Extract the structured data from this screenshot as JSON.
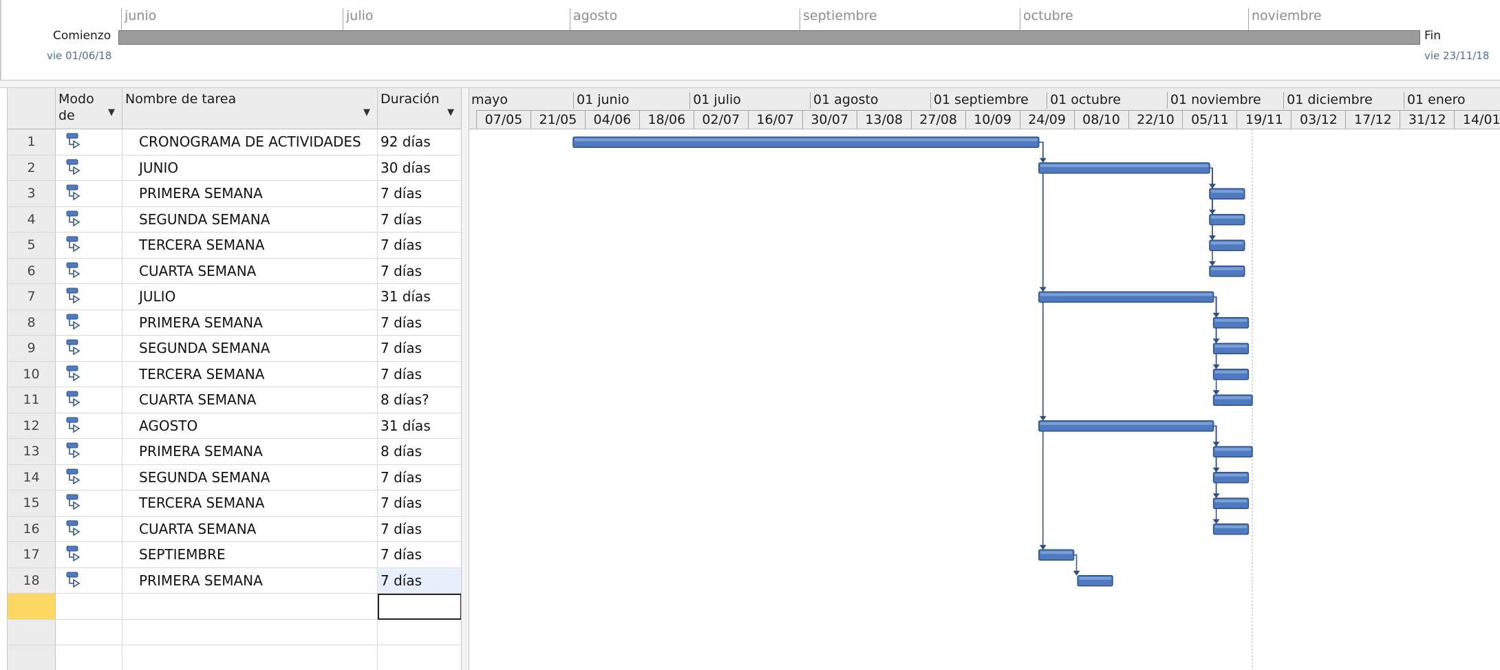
{
  "timeline": {
    "months": [
      "junio",
      "julio",
      "agosto",
      "septiembre",
      "octubre",
      "noviembre"
    ],
    "start_label": "Comienzo",
    "start_date": "vie 01/06/18",
    "end_label": "Fin",
    "end_date": "vie 23/11/18"
  },
  "table": {
    "headers": {
      "mode": "Modo de",
      "name": "Nombre de tarea",
      "duration": "Duración"
    },
    "icons": {
      "mode": "auto-schedule-task-icon",
      "dropdown": "dropdown-arrow-icon"
    },
    "rows": [
      {
        "id": "1",
        "name": "CRONOGRAMA DE ACTIVIDADES",
        "duration": "92 días"
      },
      {
        "id": "2",
        "name": "JUNIO",
        "duration": "30 días"
      },
      {
        "id": "3",
        "name": "PRIMERA SEMANA",
        "duration": "7 días"
      },
      {
        "id": "4",
        "name": "SEGUNDA SEMANA",
        "duration": "7 días"
      },
      {
        "id": "5",
        "name": "TERCERA SEMANA",
        "duration": "7 días"
      },
      {
        "id": "6",
        "name": "CUARTA SEMANA",
        "duration": "7 días"
      },
      {
        "id": "7",
        "name": "JULIO",
        "duration": "31 días"
      },
      {
        "id": "8",
        "name": "PRIMERA SEMANA",
        "duration": "7 días"
      },
      {
        "id": "9",
        "name": "SEGUNDA SEMANA",
        "duration": "7 días"
      },
      {
        "id": "10",
        "name": "TERCERA SEMANA",
        "duration": "7 días"
      },
      {
        "id": "11",
        "name": "CUARTA SEMANA",
        "duration": "8 días?"
      },
      {
        "id": "12",
        "name": "AGOSTO",
        "duration": "31 días"
      },
      {
        "id": "13",
        "name": "PRIMERA SEMANA",
        "duration": "8 días"
      },
      {
        "id": "14",
        "name": "SEGUNDA SEMANA",
        "duration": "7 días"
      },
      {
        "id": "15",
        "name": "TERCERA SEMANA",
        "duration": "7 días"
      },
      {
        "id": "16",
        "name": "CUARTA SEMANA",
        "duration": "7 días"
      },
      {
        "id": "17",
        "name": "SEPTIEMBRE",
        "duration": "7 días"
      },
      {
        "id": "18",
        "name": "PRIMERA SEMANA",
        "duration": "7 días"
      }
    ]
  },
  "gantt": {
    "months": [
      "mayo",
      "01 junio",
      "01 julio",
      "01 agosto",
      "01 septiembre",
      "01 octubre",
      "01 noviembre",
      "01 diciembre",
      "01 enero"
    ],
    "weeks": [
      "07/05",
      "21/05",
      "04/06",
      "18/06",
      "02/07",
      "16/07",
      "30/07",
      "13/08",
      "27/08",
      "10/09",
      "24/09",
      "08/10",
      "22/10",
      "05/11",
      "19/11",
      "03/12",
      "17/12",
      "31/12",
      "14/01"
    ],
    "colors": {
      "bar": "#4f7ac0",
      "bar_border": "#2e5189",
      "link": "#2e4f85"
    },
    "bars": [
      {
        "row": 1,
        "start": "2018-06-01",
        "end": "2018-09-29"
      },
      {
        "row": 2,
        "start": "2018-09-29",
        "end": "2018-11-12"
      },
      {
        "row": 3,
        "start": "2018-11-12",
        "end": "2018-11-21"
      },
      {
        "row": 4,
        "start": "2018-11-12",
        "end": "2018-11-21"
      },
      {
        "row": 5,
        "start": "2018-11-12",
        "end": "2018-11-21"
      },
      {
        "row": 6,
        "start": "2018-11-12",
        "end": "2018-11-21"
      },
      {
        "row": 7,
        "start": "2018-09-29",
        "end": "2018-11-13"
      },
      {
        "row": 8,
        "start": "2018-11-13",
        "end": "2018-11-22"
      },
      {
        "row": 9,
        "start": "2018-11-13",
        "end": "2018-11-22"
      },
      {
        "row": 10,
        "start": "2018-11-13",
        "end": "2018-11-22"
      },
      {
        "row": 11,
        "start": "2018-11-13",
        "end": "2018-11-23"
      },
      {
        "row": 12,
        "start": "2018-09-29",
        "end": "2018-11-13"
      },
      {
        "row": 13,
        "start": "2018-11-13",
        "end": "2018-11-23"
      },
      {
        "row": 14,
        "start": "2018-11-13",
        "end": "2018-11-22"
      },
      {
        "row": 15,
        "start": "2018-11-13",
        "end": "2018-11-22"
      },
      {
        "row": 16,
        "start": "2018-11-13",
        "end": "2018-11-22"
      },
      {
        "row": 17,
        "start": "2018-09-29",
        "end": "2018-10-08"
      },
      {
        "row": 18,
        "start": "2018-10-09",
        "end": "2018-10-18"
      }
    ],
    "links": [
      {
        "from": 1,
        "to": 2
      },
      {
        "from": 2,
        "to": 3
      },
      {
        "from": 2,
        "to": 4
      },
      {
        "from": 2,
        "to": 5
      },
      {
        "from": 2,
        "to": 6
      },
      {
        "from": 1,
        "to": 7
      },
      {
        "from": 7,
        "to": 8
      },
      {
        "from": 7,
        "to": 9
      },
      {
        "from": 7,
        "to": 10
      },
      {
        "from": 7,
        "to": 11
      },
      {
        "from": 1,
        "to": 12
      },
      {
        "from": 12,
        "to": 13
      },
      {
        "from": 12,
        "to": 14
      },
      {
        "from": 12,
        "to": 15
      },
      {
        "from": 12,
        "to": 16
      },
      {
        "from": 1,
        "to": 17
      },
      {
        "from": 17,
        "to": 18
      }
    ],
    "status_date": "2018-11-23"
  }
}
